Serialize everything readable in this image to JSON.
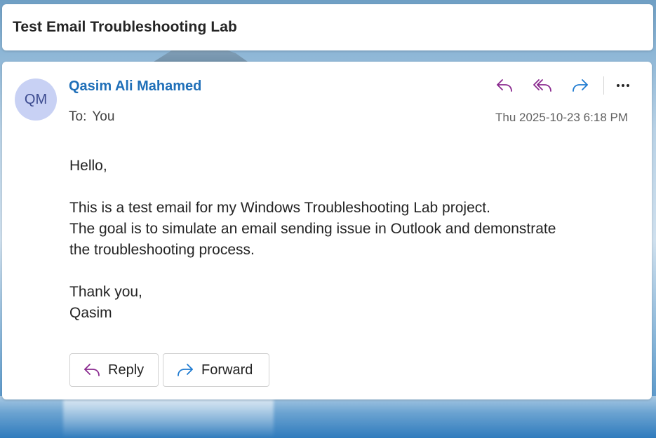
{
  "subject": "Test Email Troubleshooting Lab",
  "sender": {
    "initials": "QM",
    "name": "Qasim Ali Mahamed"
  },
  "recipients": {
    "label": "To:",
    "value": "You"
  },
  "date": "Thu 2025-10-23 6:18 PM",
  "toolbar": {
    "icons": [
      "reply-icon",
      "reply-all-icon",
      "forward-icon",
      "more-icon"
    ]
  },
  "body": {
    "greeting": "Hello,",
    "line1": "This is a test email for my Windows Troubleshooting Lab project.",
    "line2": "The goal is to simulate an email sending issue in Outlook and demonstrate",
    "line3": "the troubleshooting process.",
    "closing": "Thank you,",
    "signature": "Qasim"
  },
  "buttons": {
    "reply_label": "Reply",
    "forward_label": "Forward"
  },
  "colors": {
    "accent_link": "#1f6fb8",
    "reply_icon": "#8a2a8f",
    "forward_icon": "#1f7bd1",
    "avatar_bg": "#c8d1f4"
  }
}
